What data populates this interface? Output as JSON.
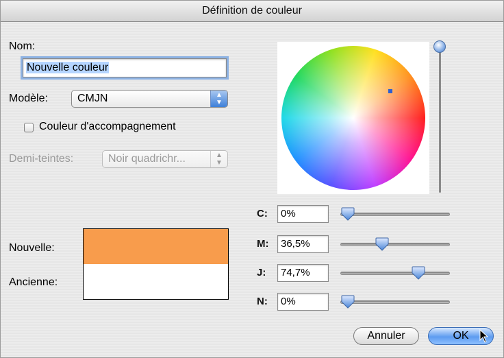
{
  "window": {
    "title": "Définition de couleur"
  },
  "name": {
    "label": "Nom:",
    "value": "Nouvelle couleur"
  },
  "model": {
    "label": "Modèle:",
    "value": "CMJN"
  },
  "spot": {
    "label": "Couleur d'accompagnement",
    "checked": false
  },
  "halftone": {
    "label": "Demi-teintes:",
    "value": "Noir quadrichr..."
  },
  "preview": {
    "new_label": "Nouvelle:",
    "old_label": "Ancienne:",
    "new_color": "#f89c4c",
    "old_color": "#ffffff"
  },
  "channels": [
    {
      "label": "C:",
      "value": "0%",
      "level": 0
    },
    {
      "label": "M:",
      "value": "36,5%",
      "level": 36.5
    },
    {
      "label": "J:",
      "value": "74,7%",
      "level": 74.7
    },
    {
      "label": "N:",
      "value": "0%",
      "level": 0
    }
  ],
  "brightness": {
    "level": 100
  },
  "buttons": {
    "cancel": "Annuler",
    "ok": "OK"
  },
  "icons": {
    "up_down_arrows": "popup-arrows-icon",
    "cursor": "pointer-cursor-icon"
  }
}
